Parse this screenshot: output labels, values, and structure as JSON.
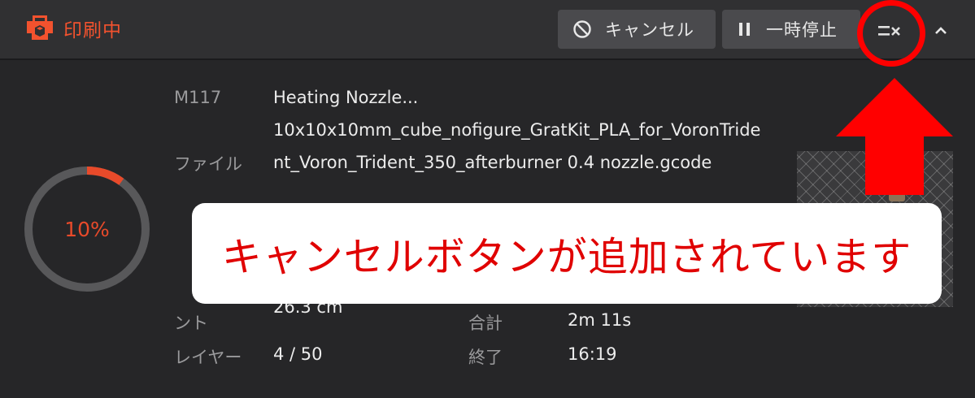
{
  "header": {
    "title": "印刷中",
    "cancel_label": "キャンセル",
    "pause_label": "一時停止",
    "icons": {
      "logo": "printer-logo-icon",
      "cancel": "ban-icon",
      "pause": "pause-icon",
      "clear": "clear-list-icon",
      "collapse": "chevron-up-icon"
    }
  },
  "progress": {
    "percent_label": "10%",
    "fraction": 0.1,
    "color": "#e84a2a"
  },
  "status": {
    "m117_key": "M117",
    "m117_value": "Heating Nozzle...",
    "file_key": "ファイル",
    "file_value": "10x10x10mm_cube_nofigure_GratKit_PLA_for_VoronTrident_Voron_Trident_350_afterburner 0.4 nozzle.gcode",
    "filament_key_tail": "ント",
    "filament_value": "26.3 cm",
    "layer_key": "レイヤー",
    "layer_value": "4 / 50",
    "total_key": "合計",
    "total_value": "2m 11s",
    "end_key": "終了",
    "end_value": "16:19"
  },
  "callout": {
    "text": "キャンセルボタンが追加されています"
  },
  "colors": {
    "accent": "#f2522e",
    "annotation_red": "#ff0000",
    "header_bg": "#303032",
    "body_bg": "#262628",
    "button_bg": "#4a4a4d"
  }
}
